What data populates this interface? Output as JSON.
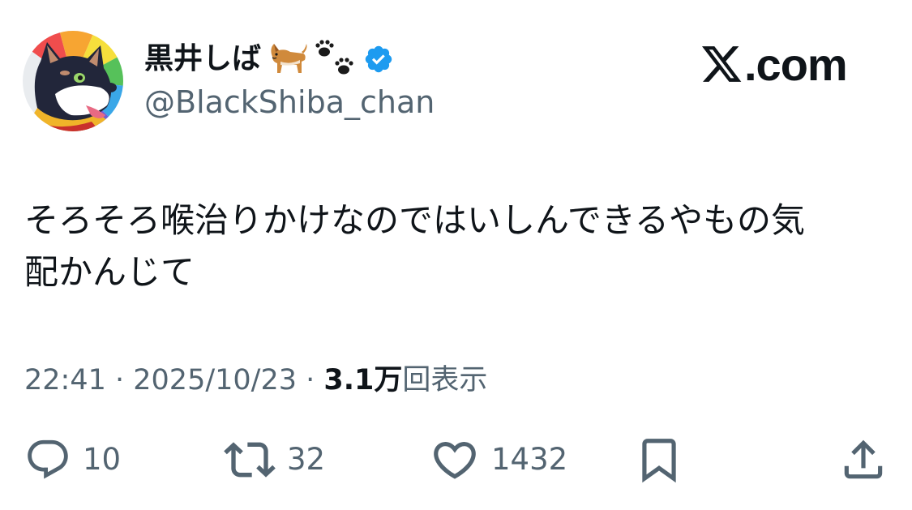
{
  "author": {
    "display_name": "黒井しば",
    "name_emoji": [
      "dog-emoji",
      "paw-prints-emoji"
    ],
    "verified": true,
    "handle": "@BlackShiba_chan",
    "avatar": "black-shiba-dog-avatar"
  },
  "brand": {
    "logo": "x-logo",
    "suffix": ".com"
  },
  "tweet": {
    "text_line1": "そろそろ喉治りかけなのではいしんできるやもの気",
    "text_line2": "配かんじて"
  },
  "meta": {
    "time": "22:41",
    "sep1": " · ",
    "date": "2025/10/23",
    "sep2": " · ",
    "views_count": "3.1万",
    "views_label": "回表示"
  },
  "actions": {
    "replies": "10",
    "retweets": "32",
    "likes": "1432"
  },
  "colors": {
    "text": "#0f1419",
    "secondary": "#536471",
    "verified": "#1d9bf0"
  }
}
